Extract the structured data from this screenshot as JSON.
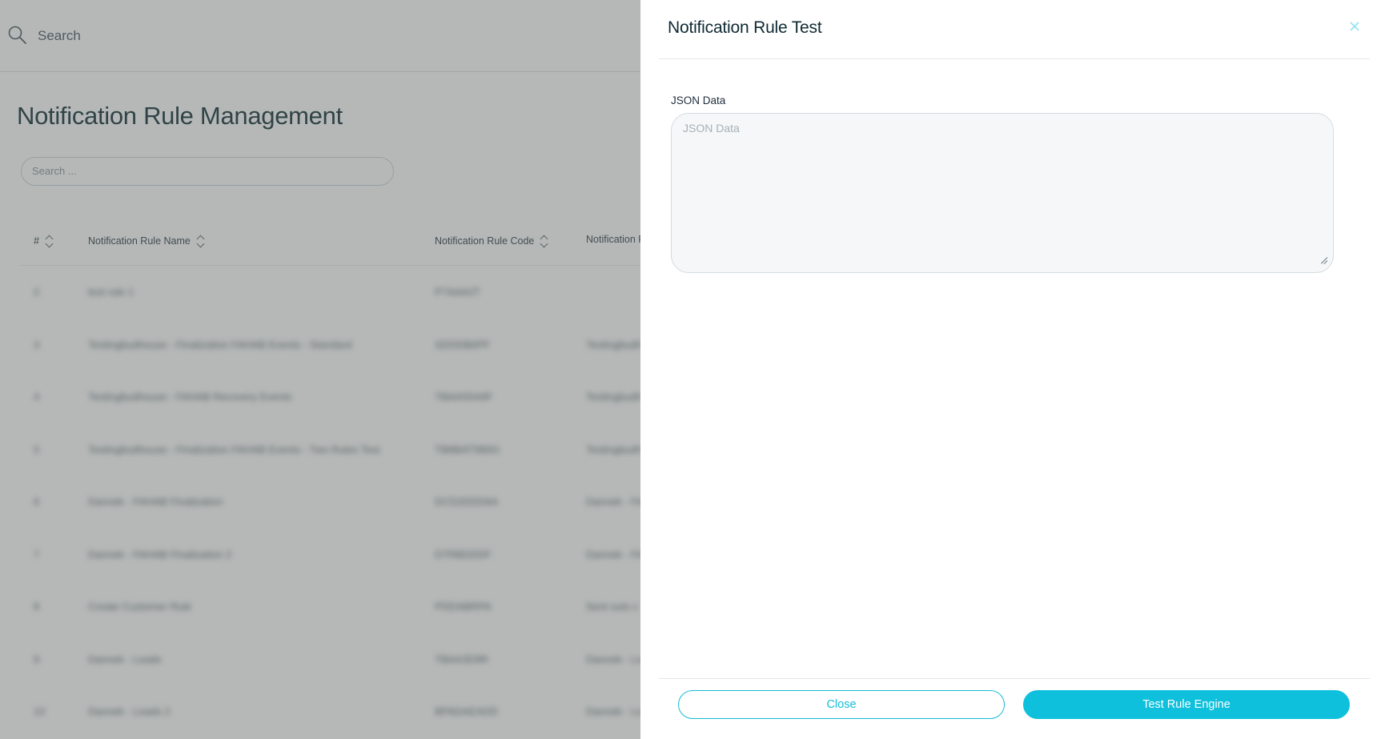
{
  "topbar": {
    "search_label": "Search"
  },
  "page": {
    "title": "Notification Rule Management",
    "search_placeholder": "Search ..."
  },
  "table": {
    "columns": [
      "#",
      "Notification Rule Name",
      "Notification Rule Code",
      "Notification R"
    ],
    "rows": [
      [
        "2",
        "test rule 1",
        "P7AAA2T",
        ""
      ],
      [
        "3",
        "Testingbudhouse - Finalization FAHAB Events - Standard",
        "SDDDB6PF",
        "Testingbudh"
      ],
      [
        "4",
        "Testingbudhouse - FAHAB Recovery Events",
        "TBAA55A9F",
        "Testingbudh"
      ],
      [
        "5",
        "Testingbudhouse - Finalization FAHAB Events - Two Rules Test",
        "TB8BAT5B9G",
        "Testingbudh"
      ],
      [
        "6",
        "Dannek - FAHAB Finalization",
        "DCD2DDD6A",
        "Dannek - FA"
      ],
      [
        "7",
        "Dannek - FAHAB Finalization 2",
        "D7RBDDDF",
        "Dannek - FA"
      ],
      [
        "8",
        "Create Customer Rule",
        "PDDABRPA",
        "Sent outs c"
      ],
      [
        "9",
        "Dannek - Leads",
        "TBAA3D9R",
        "Dannek - Le"
      ],
      [
        "10",
        "Dannek - Leads 2",
        "BPADAEADD",
        "Dannek - Le"
      ]
    ]
  },
  "drawer": {
    "title": "Notification Rule Test",
    "json_label": "JSON Data",
    "json_placeholder": "JSON Data",
    "close_label": "Close",
    "test_label": "Test Rule Engine"
  },
  "colors": {
    "accent": "#0ec0dc",
    "overlay": "#5a6260"
  },
  "icons": {
    "topbar_search": "search-icon",
    "drawer_close": "close-icon",
    "sort": "sort-icon"
  }
}
